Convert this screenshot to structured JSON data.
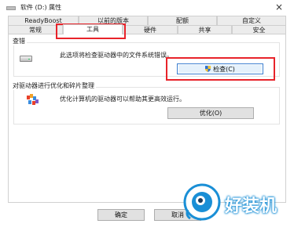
{
  "window": {
    "title": "软件 (D:) 属性",
    "close_label": "×"
  },
  "tabs_row1": [
    "ReadyBoost",
    "以前的版本",
    "配额",
    "自定义"
  ],
  "tabs_row2": [
    "常规",
    "工具",
    "硬件",
    "共享",
    "安全"
  ],
  "selected_tab": "工具",
  "check_section": {
    "title": "查错",
    "description": "此选项将检查驱动器中的文件系统错误。",
    "button_label": "检查(C)"
  },
  "optimize_section": {
    "title": "对驱动器进行优化和碎片整理",
    "description": "优化计算机的驱动器可以帮助其更高效运行。",
    "button_label": "优化(O)"
  },
  "footer": {
    "ok_label": "确定",
    "cancel_label": "取消"
  },
  "watermark": {
    "text": "好装机"
  },
  "colors": {
    "highlight": "#e8232a",
    "focus_border": "#3c7fd0",
    "watermark": "#1a8fd6"
  }
}
